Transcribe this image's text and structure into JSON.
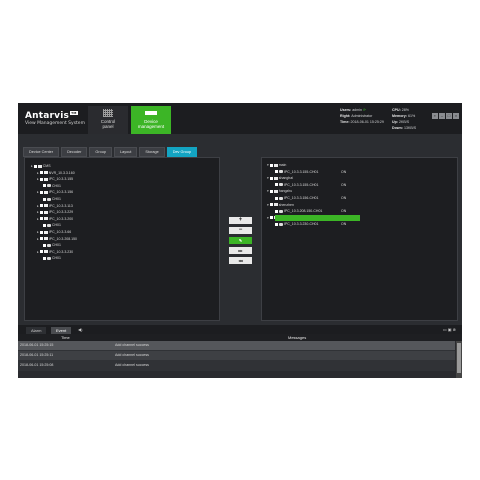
{
  "brand": {
    "name": "Antarvis",
    "tm": "TM",
    "subtitle": "View Management System"
  },
  "nav": [
    {
      "label1": "Control",
      "label2": "panel",
      "icon": "grid-icon"
    },
    {
      "label1": "Device",
      "label2": "management",
      "icon": "device-icon"
    }
  ],
  "info": {
    "user_k": "Users:",
    "user_v": "admin",
    "right_k": "Right:",
    "right_v": "Administrator",
    "time_k": "Time:",
    "time_v": "2018-06-01 15:25:29",
    "cpu_k": "CPU:",
    "cpu_v": "28%",
    "mem_k": "Memory:",
    "mem_v": "61%",
    "up_k": "Up:",
    "up_v": "2KB/S",
    "down_k": "Down:",
    "down_v": "13KB/S"
  },
  "tabs": [
    {
      "label": "Device Center",
      "active": false
    },
    {
      "label": "Decoder",
      "active": false
    },
    {
      "label": "Group",
      "active": false
    },
    {
      "label": "Layout",
      "active": false
    },
    {
      "label": "Storage",
      "active": false
    },
    {
      "label": "Dev Group",
      "active": true
    }
  ],
  "left_tree": [
    {
      "label": "CMS",
      "level": 0,
      "type": "folder"
    },
    {
      "label": "NVR_10.3.3.160",
      "level": 1,
      "type": "device"
    },
    {
      "label": "IPC_10.3.3.155",
      "level": 1,
      "type": "device"
    },
    {
      "label": "CH01",
      "level": 2,
      "type": "channel"
    },
    {
      "label": "IPC_10.3.3.156",
      "level": 1,
      "type": "device"
    },
    {
      "label": "CH01",
      "level": 2,
      "type": "channel"
    },
    {
      "label": "IPC_10.3.3.113",
      "level": 1,
      "type": "device"
    },
    {
      "label": "IPC_10.3.3.229",
      "level": 1,
      "type": "device"
    },
    {
      "label": "IPC_10.3.3.200",
      "level": 1,
      "type": "device"
    },
    {
      "label": "CH01",
      "level": 2,
      "type": "channel"
    },
    {
      "label": "IPC_10.3.3.66",
      "level": 1,
      "type": "device"
    },
    {
      "label": "IPC_10.3.208.150",
      "level": 1,
      "type": "device"
    },
    {
      "label": "CH01",
      "level": 2,
      "type": "channel"
    },
    {
      "label": "IPC_10.3.3.230",
      "level": 1,
      "type": "device"
    },
    {
      "label": "CH01",
      "level": 2,
      "type": "channel"
    }
  ],
  "right_tree": [
    {
      "label": "main",
      "level": 0,
      "type": "folder",
      "status": ""
    },
    {
      "label": "IPC_10.3.3.155-CH01",
      "level": 1,
      "type": "channel",
      "status": "ON"
    },
    {
      "label": "shanghai",
      "level": 0,
      "type": "folder",
      "status": ""
    },
    {
      "label": "IPC_10.3.3.155-CH01",
      "level": 1,
      "type": "channel",
      "status": "ON"
    },
    {
      "label": "hangzhu",
      "level": 0,
      "type": "folder",
      "status": ""
    },
    {
      "label": "IPC_10.3.3.156-CH01",
      "level": 1,
      "type": "channel",
      "status": "ON"
    },
    {
      "label": "shenzhen",
      "level": 0,
      "type": "folder",
      "status": ""
    },
    {
      "label": "IPC_10.3.208.150-CH01",
      "level": 1,
      "type": "channel",
      "status": "ON"
    },
    {
      "label": "beijing",
      "level": 0,
      "type": "folder",
      "status": ""
    },
    {
      "label": "IPC_10.3.3.230-CH01",
      "level": 1,
      "type": "channel",
      "status": "ON"
    }
  ],
  "mid_buttons": [
    "+",
    "−",
    "✎",
    "▸▸",
    "◂◂"
  ],
  "bottom_tabs": [
    {
      "label": "Alarm",
      "active": false
    },
    {
      "label": "Event",
      "active": true
    }
  ],
  "log": {
    "col_time": "Time",
    "col_msg": "Messages",
    "rows": [
      {
        "time": "2018-06-01 15:25:15",
        "msg": "Add channel success"
      },
      {
        "time": "2018-06-01 15:25:11",
        "msg": "Add channel success"
      },
      {
        "time": "2018-06-01 15:25:08",
        "msg": "Add channel success"
      }
    ]
  },
  "colors": {
    "accent_green": "#3cb526",
    "accent_blue": "#13a4c2",
    "bg": "#2b2d31"
  }
}
